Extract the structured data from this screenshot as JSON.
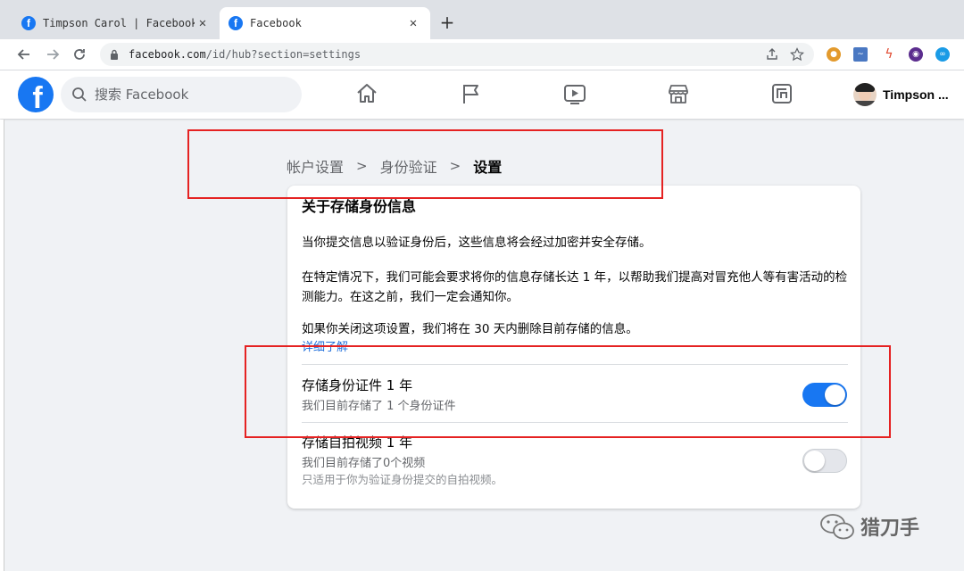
{
  "browser": {
    "tabs": [
      {
        "title": "Timpson Carol | Facebook",
        "active": false
      },
      {
        "title": "Facebook",
        "active": true
      }
    ],
    "new_tab_label": "+",
    "close_label": "✕",
    "url_host": "facebook.com",
    "url_path": "/id/hub?section=settings"
  },
  "fb": {
    "logo_letter": "f",
    "search_placeholder": "搜索 Facebook",
    "profile_name": "Timpson ...",
    "nav_icons": [
      "home-icon",
      "flag-icon",
      "video-icon",
      "marketplace-icon",
      "gaming-icon"
    ]
  },
  "breadcrumb": {
    "items": [
      "帐户设置",
      "身份验证",
      "设置"
    ],
    "separator": ">"
  },
  "card": {
    "heading": "关于存储身份信息",
    "para1": "当你提交信息以验证身份后，这些信息将会经过加密并安全存储。",
    "para2": "在特定情况下，我们可能会要求将你的信息存储长达 1 年，以帮助我们提高对冒充他人等有害活动的检测能力。在这之前，我们一定会通知你。",
    "para3": "如果你关闭这项设置，我们将在 30 天内删除目前存储的信息。",
    "learn_more": "详细了解",
    "settings": [
      {
        "title": "存储身份证件 1 年",
        "subtitle": "我们目前存储了 1 个身份证件",
        "note": "",
        "enabled": true
      },
      {
        "title": "存储自拍视频 1 年",
        "subtitle": "我们目前存储了0个视频",
        "note": "只适用于你为验证身份提交的自拍视频。",
        "enabled": false
      }
    ]
  },
  "watermark": "猎刀手",
  "colors": {
    "fb_blue": "#1877f2",
    "annotation_red": "#e52222",
    "link_blue": "#216fdb"
  }
}
